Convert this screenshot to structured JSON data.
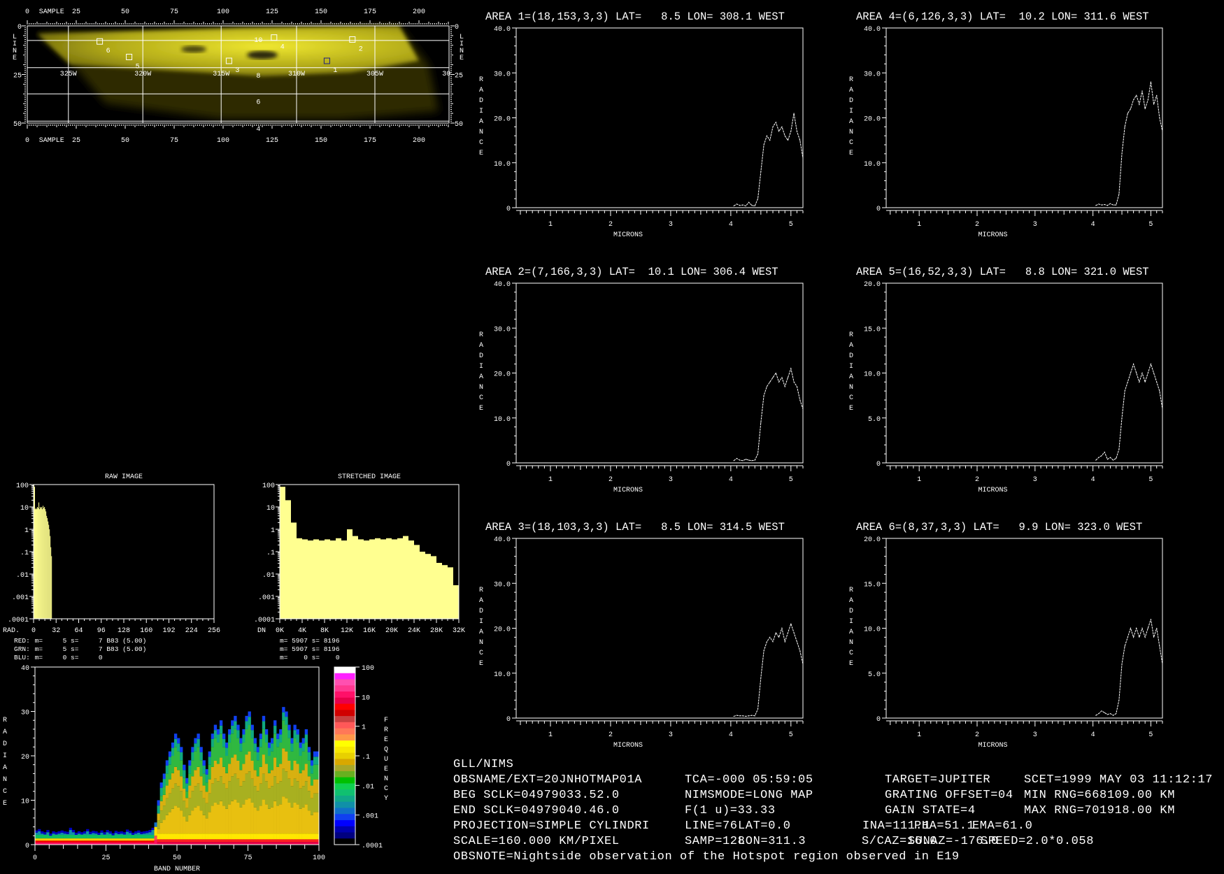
{
  "map": {
    "sample_label": "SAMPLE",
    "line_letters": [
      "L",
      "I",
      "N",
      "E"
    ],
    "sample_ticks": [
      "0",
      "25",
      "50",
      "75",
      "100",
      "125",
      "150",
      "175",
      "200"
    ],
    "line_ticks": [
      "0",
      "25",
      "50"
    ],
    "lon_labels": [
      "325W",
      "320W",
      "315W",
      "310W",
      "305W",
      "30"
    ],
    "lat_labels": [
      "10",
      "8",
      "6",
      "4"
    ],
    "areas": [
      {
        "id": "1",
        "line": 18,
        "sample": 153
      },
      {
        "id": "2",
        "line": 7,
        "sample": 166
      },
      {
        "id": "3",
        "line": 18,
        "sample": 103
      },
      {
        "id": "4",
        "line": 6,
        "sample": 126
      },
      {
        "id": "5",
        "line": 16,
        "sample": 52
      },
      {
        "id": "6",
        "line": 8,
        "sample": 37
      }
    ]
  },
  "chart_data": [
    {
      "type": "line",
      "panels_common": {
        "xlabel": "MICRONS",
        "ylabel": "RADIANCE",
        "xticks": [
          "1",
          "2",
          "3",
          "4",
          "5"
        ],
        "xlim": [
          0.43,
          5.2
        ],
        "x": [
          4.05,
          4.1,
          4.15,
          4.2,
          4.25,
          4.3,
          4.35,
          4.4,
          4.45,
          4.5,
          4.55,
          4.6,
          4.65,
          4.7,
          4.75,
          4.8,
          4.85,
          4.9,
          4.95,
          5.0,
          5.05,
          5.1,
          5.15,
          5.2
        ]
      },
      "panels": [
        {
          "title": "AREA 1=(18,153,3,3) LAT=   8.5 LON= 308.1 WEST",
          "ylim": [
            0,
            40
          ],
          "yticks": [
            "0",
            "10.0",
            "20.0",
            "30.0",
            "40.0"
          ],
          "values": [
            0.4,
            0.8,
            0.5,
            0.6,
            0.4,
            1.2,
            0.5,
            0.4,
            2,
            8,
            14,
            16,
            15,
            18,
            19,
            17,
            18,
            16,
            15,
            17,
            21,
            17,
            15,
            11
          ]
        },
        {
          "title": "AREA 2=(7,166,3,3) LAT=  10.1 LON= 306.4 WEST",
          "ylim": [
            0,
            40
          ],
          "yticks": [
            "0",
            "10.0",
            "20.0",
            "30.0",
            "40.0"
          ],
          "values": [
            0.5,
            1.0,
            0.6,
            0.5,
            0.8,
            0.6,
            0.5,
            0.6,
            2,
            9,
            15,
            17,
            18,
            19,
            20,
            18,
            19,
            17,
            19,
            21,
            18,
            17,
            14,
            12
          ]
        },
        {
          "title": "AREA 3=(18,103,3,3) LAT=   8.5 LON= 314.5 WEST",
          "ylim": [
            0,
            40
          ],
          "yticks": [
            "0",
            "10.0",
            "20.0",
            "30.0",
            "40.0"
          ],
          "values": [
            0.4,
            0.6,
            0.5,
            0.5,
            0.4,
            0.5,
            0.6,
            0.5,
            2,
            9,
            15,
            17,
            18,
            17,
            19,
            18,
            20,
            17,
            19,
            21,
            19,
            17,
            15,
            12
          ]
        },
        {
          "title": "AREA 4=(6,126,3,3) LAT=  10.2 LON= 311.6 WEST",
          "ylim": [
            0,
            40
          ],
          "yticks": [
            "0",
            "10.0",
            "20.0",
            "30.0",
            "40.0"
          ],
          "values": [
            0.5,
            0.8,
            0.6,
            0.7,
            0.5,
            0.9,
            0.6,
            0.6,
            3,
            12,
            18,
            21,
            22,
            24,
            25,
            23,
            26,
            22,
            24,
            28,
            23,
            25,
            20,
            17
          ]
        },
        {
          "title": "AREA 5=(16,52,3,3) LAT=   8.8 LON= 321.0 WEST",
          "ylim": [
            0,
            20
          ],
          "yticks": [
            "0",
            "5.0",
            "10.0",
            "15.0",
            "20.0"
          ],
          "values": [
            0.3,
            0.6,
            0.8,
            1.2,
            0.4,
            0.6,
            0.3,
            0.5,
            1.5,
            5,
            8,
            9,
            10,
            11,
            10,
            9,
            10,
            9,
            10,
            11,
            10,
            9,
            8,
            6
          ]
        },
        {
          "title": "AREA 6=(8,37,3,3) LAT=   9.9 LON= 323.0 WEST",
          "ylim": [
            0,
            20
          ],
          "yticks": [
            "0",
            "5.0",
            "10.0",
            "15.0",
            "20.0"
          ],
          "values": [
            0.3,
            0.5,
            0.8,
            0.6,
            0.4,
            0.5,
            0.3,
            0.5,
            2,
            6,
            8,
            9,
            10,
            9,
            10,
            9,
            10,
            9,
            10,
            11,
            9,
            10,
            8,
            6
          ]
        }
      ]
    },
    {
      "type": "bar",
      "title": "RAW IMAGE",
      "xlabel": "RAD.",
      "xticks": [
        "0",
        "32",
        "64",
        "96",
        "128",
        "160",
        "192",
        "224",
        "256"
      ],
      "xlim": [
        0,
        256
      ],
      "yticks": [
        "100",
        "10",
        "1",
        ".1",
        ".01",
        ".001",
        ".0001"
      ],
      "ylim_log10": [
        -4,
        2
      ],
      "bin_width": 1,
      "log10_values": [
        2,
        1.9,
        0.9,
        0.95,
        0.9,
        1,
        0.95,
        1.2,
        0.9,
        1,
        0.95,
        1,
        0.9,
        1.05,
        0.95,
        1,
        0.9,
        0.8,
        0.6,
        0.5,
        0.35,
        0.2,
        0,
        -0.3,
        -0.8,
        -1.2
      ],
      "stats": [
        {
          "label": "RED:",
          "text": " m=     5 s=     7 B83 (5.00)",
          "color": "#ff2020"
        },
        {
          "label": "GRN:",
          "text": " m=     5 s=     7 B83 (5.00)",
          "color": "#ffff60"
        },
        {
          "label": "BLU:",
          "text": " m=     0 s=     0",
          "color": "#5050ff"
        }
      ]
    },
    {
      "type": "bar",
      "title": "STRETCHED IMAGE",
      "xlabel": "DN",
      "xticks": [
        "0K",
        "4K",
        "8K",
        "12K",
        "16K",
        "20K",
        "24K",
        "28K",
        "32K"
      ],
      "xlim": [
        0,
        32
      ],
      "yticks": [
        "100",
        "10",
        "1",
        ".1",
        ".01",
        ".001",
        ".0001"
      ],
      "ylim_log10": [
        -4,
        2
      ],
      "bin_width": 1,
      "log10_values": [
        1.9,
        1.3,
        0.3,
        -0.4,
        -0.45,
        -0.5,
        -0.45,
        -0.5,
        -0.45,
        -0.5,
        -0.4,
        -0.5,
        0,
        -0.3,
        -0.45,
        -0.5,
        -0.45,
        -0.4,
        -0.45,
        -0.4,
        -0.45,
        -0.4,
        -0.3,
        -0.5,
        -0.7,
        -1,
        -1.1,
        -1.2,
        -1.5,
        -1.6,
        -1.7,
        -2.5
      ],
      "stats": [
        "m= 5907 s= 8196",
        "m= 5907 s= 8196",
        "m=    0 s=    0"
      ]
    },
    {
      "type": "heatmap",
      "xlabel": "BAND NUMBER",
      "ylabel": "RADIANCE",
      "xticks": [
        "0",
        "25",
        "50",
        "75",
        "100"
      ],
      "yticks": [
        "0",
        "10",
        "20",
        "30",
        "40"
      ],
      "xlim": [
        0,
        100
      ],
      "ylim": [
        0,
        40
      ],
      "band_max_radiance": [
        3.2,
        3.5,
        3,
        2.8,
        3.3,
        2.5,
        3,
        2.8,
        3,
        3.2,
        3,
        2.9,
        3.8,
        3.3,
        2.7,
        3,
        2.8,
        3,
        3.5,
        2.9,
        3.1,
        3,
        2.7,
        3.2,
        2.8,
        3.3,
        3,
        2.6,
        3.1,
        2.9,
        3,
        2.8,
        3.4,
        3.1,
        2.7,
        3,
        3.2,
        2.9,
        3,
        3.1,
        3.3,
        3.8,
        5,
        10,
        14,
        16,
        19,
        21,
        23,
        25,
        24,
        22,
        18,
        15,
        19,
        22,
        24,
        25,
        22,
        19,
        17,
        21,
        25,
        27,
        26,
        28,
        25,
        23,
        26,
        28,
        29,
        27,
        24,
        26,
        29,
        30,
        27,
        24,
        22,
        25,
        29,
        26,
        23,
        24,
        28,
        25,
        26,
        31,
        30,
        27,
        24,
        27,
        26,
        23,
        24,
        26,
        22,
        19,
        21,
        21
      ],
      "colorbar": {
        "label": "FREQUENCY",
        "ticks": [
          "100",
          "10",
          "1",
          ".1",
          ".01",
          ".001",
          ".0001"
        ],
        "colors_top_to_bottom": [
          "#ffffff",
          "#ff20ff",
          "#ff50b0",
          "#ff3890",
          "#ff1068",
          "#e8004a",
          "#ff0000",
          "#d00000",
          "#c84040",
          "#ff5858",
          "#ff7858",
          "#ff9848",
          "#ffff00",
          "#f8e800",
          "#e8d000",
          "#d8a800",
          "#a8a828",
          "#68b020",
          "#00c000",
          "#10d050",
          "#10c070",
          "#10a888",
          "#1090a8",
          "#1070c8",
          "#1040f0",
          "#0000ff",
          "#0000b0",
          "#000080",
          "#000000"
        ]
      }
    }
  ],
  "info": {
    "header": "GLL/NIMS",
    "obsname": "OBSNAME/EXT=20JNHOTMAP01A",
    "tca": "TCA=-000 05:59:05",
    "target": "TARGET=JUPITER",
    "scet": "SCET=1999 MAY 03 11:12:17",
    "beg_sclk": "BEG SCLK=04979033.52.0",
    "nimsmode": "NIMSMODE=LONG MAP",
    "grating": "GRATING OFFSET=04",
    "min_rng": "MIN RNG=668109.00 KM",
    "end_sclk": "END SCLK=04979040.46.0",
    "f1u": "F(1 u)=33.33",
    "gain": "GAIN STATE=4",
    "max_rng": "MAX RNG=701918.00 KM",
    "projection": "PROJECTION=SIMPLE CYLINDRI",
    "line": "LINE=76",
    "lat": "LAT=0.0",
    "ina": "INA=111.1",
    "pha": "PHA=51.1",
    "ema": "EMA=61.0",
    "scale": "SCALE=160.000 KM/PIXEL",
    "samp": "SAMP=128",
    "lon": "LON=311.3",
    "scaz": "S/CAZ=16.0",
    "sunaz": "SUNAZ=-176.0",
    "speed": "SPEED=2.0*0.058",
    "obsnote": "OBSNOTE=Nightside observation of the Hotspot region observed in E19"
  }
}
